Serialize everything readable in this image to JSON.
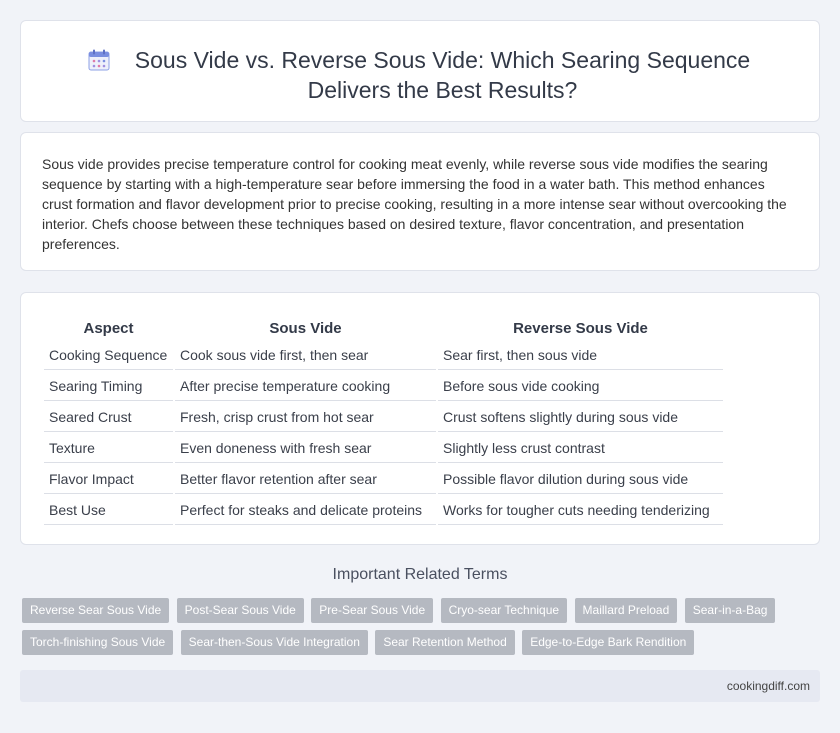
{
  "header": {
    "title": "Sous Vide vs. Reverse Sous Vide: Which Searing Sequence Delivers the Best Results?",
    "icon": "calendar-icon",
    "accent": "#7a8ee0"
  },
  "summary": {
    "text": "Sous vide provides precise temperature control for cooking meat evenly, while reverse sous vide modifies the searing sequence by starting with a high-temperature sear before immersing the food in a water bath. This method enhances crust formation and flavor development prior to precise cooking, resulting in a more intense sear without overcooking the interior. Chefs choose between these techniques based on desired texture, flavor concentration, and presentation preferences."
  },
  "table": {
    "headers": [
      "Aspect",
      "Sous Vide",
      "Reverse Sous Vide"
    ],
    "rows": [
      [
        "Cooking Sequence",
        "Cook sous vide first, then sear",
        "Sear first, then sous vide"
      ],
      [
        "Searing Timing",
        "After precise temperature cooking",
        "Before sous vide cooking"
      ],
      [
        "Seared Crust",
        "Fresh, crisp crust from hot sear",
        "Crust softens slightly during sous vide"
      ],
      [
        "Texture",
        "Even doneness with fresh sear",
        "Slightly less crust contrast"
      ],
      [
        "Flavor Impact",
        "Better flavor retention after sear",
        "Possible flavor dilution during sous vide"
      ],
      [
        "Best Use",
        "Perfect for steaks and delicate proteins",
        "Works for tougher cuts needing tenderizing"
      ]
    ]
  },
  "related": {
    "heading": "Important Related Terms",
    "tags": [
      "Reverse Sear Sous Vide",
      "Post-Sear Sous Vide",
      "Pre-Sear Sous Vide",
      "Cryo-sear Technique",
      "Maillard Preload",
      "Sear-in-a-Bag",
      "Torch-finishing Sous Vide",
      "Sear-then-Sous Vide Integration",
      "Sear Retention Method",
      "Edge-to-Edge Bark Rendition"
    ]
  },
  "footer": {
    "site": "cookingdiff.com"
  }
}
